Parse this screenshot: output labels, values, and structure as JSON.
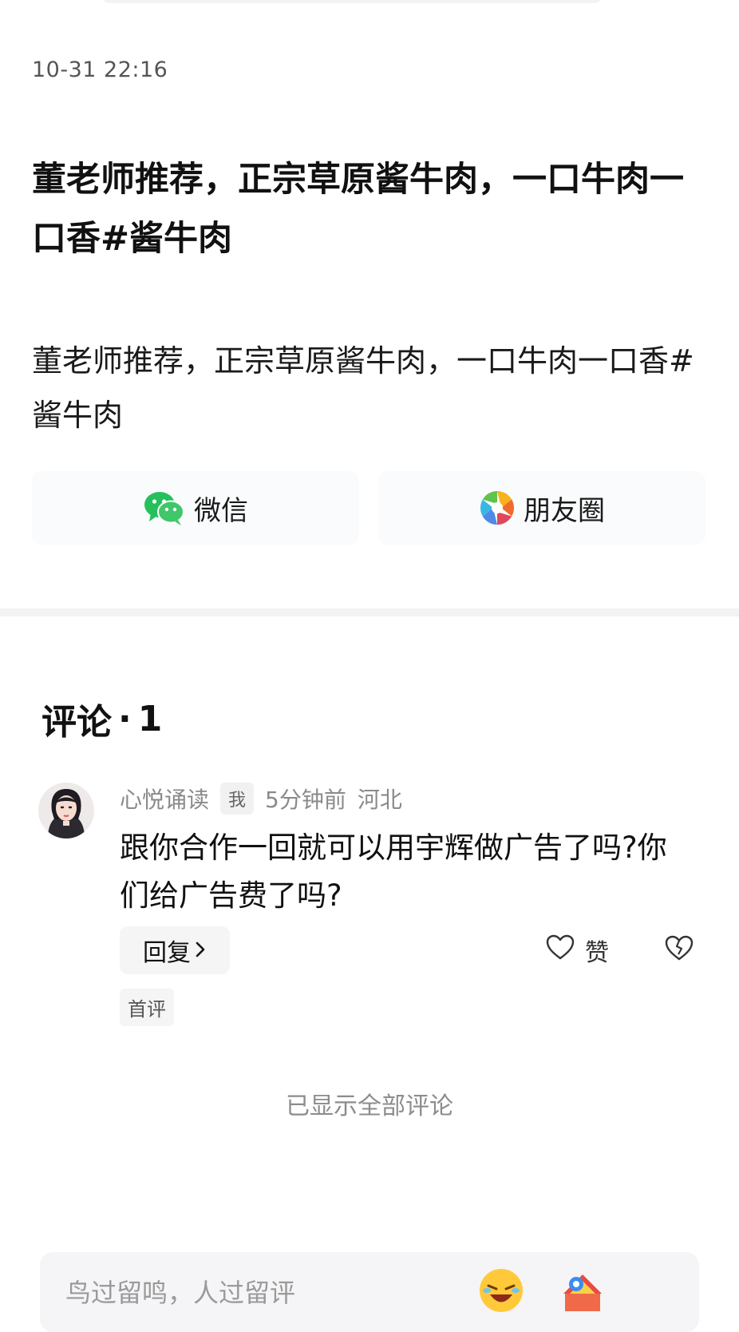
{
  "post": {
    "timestamp": "10-31 22:16",
    "title": "董老师推荐，正宗草原酱牛肉，一口牛肉一口香#酱牛肉",
    "body": "董老师推荐，正宗草原酱牛肉，一口牛肉一口香#酱牛肉"
  },
  "share": {
    "wechat_label": "微信",
    "wechat_icon": "wechat-icon",
    "moments_label": "朋友圈",
    "moments_icon": "moments-camera-icon"
  },
  "comments": {
    "heading": "评论",
    "separator": "·",
    "count": "1",
    "items": [
      {
        "username": "心悦诵读",
        "me_badge": "我",
        "time_ago": "5分钟前",
        "location": "河北",
        "text": "跟你合作一回就可以用宇辉做广告了吗?你们给广告费了吗?",
        "reply_label": "回复",
        "like_label": "赞",
        "badge": "首评"
      }
    ],
    "all_shown": "已显示全部评论"
  },
  "input": {
    "placeholder": "鸟过留鸣，人过留评"
  },
  "colors": {
    "wechat_green": "#25c05b",
    "divider": "#f2f3f5",
    "muted_text": "#8a8a8a"
  }
}
